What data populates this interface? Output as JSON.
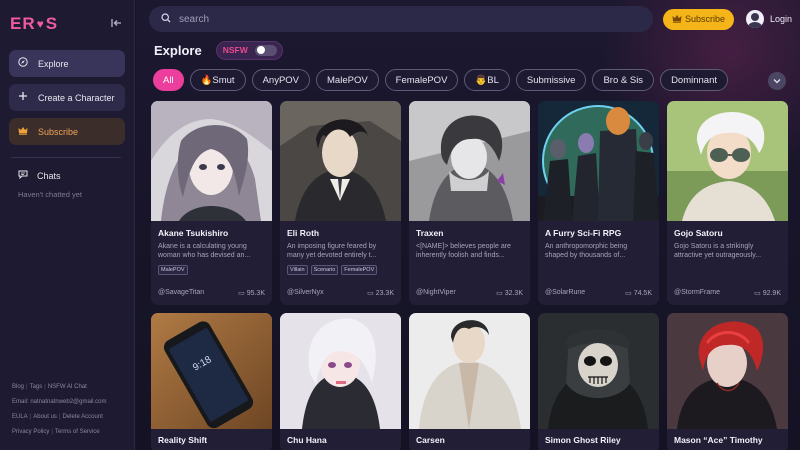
{
  "brand": {
    "logo_left": "ER",
    "logo_heart": "♥",
    "logo_right": "S"
  },
  "sidebar": {
    "collapse_icon": "collapse-icon",
    "items": [
      {
        "label": "Explore",
        "icon": "compass-icon"
      },
      {
        "label": "Create a Character",
        "icon": "plus-icon"
      },
      {
        "label": "Subscribe",
        "icon": "crown-icon"
      }
    ],
    "chats_label": "Chats",
    "chats_empty": "Haven't chatted yet",
    "footer": {
      "blog": "Blog",
      "tags": "Tags",
      "nsfw_ai_chat": "NSFW AI Chat",
      "email": "Email: natnatnatnweb2@gmail.com",
      "eula": "EULA",
      "about": "About us",
      "delete": "Delete Account",
      "privacy": "Privacy Policy",
      "terms": "Terms of Service"
    }
  },
  "header": {
    "search_placeholder": "search",
    "subscribe_label": "Subscribe",
    "login_label": "Login"
  },
  "explore": {
    "title": "Explore",
    "nsfw_label": "NSFW",
    "nsfw_on": false
  },
  "tags": [
    "All",
    "🔥Smut",
    "AnyPOV",
    "MalePOV",
    "FemalePOV",
    "👨BL",
    "Submissive",
    "Bro & Sis",
    "Dominnant"
  ],
  "cards": [
    {
      "name": "Akane Tsukishiro",
      "desc": "Akane is a calculating young woman who has devised an...",
      "chips": [
        "MalePOV"
      ],
      "author": "@SavageTitan",
      "chats": "95.3K"
    },
    {
      "name": "Eli Roth",
      "desc": "An imposing figure feared by many yet devoted entirely t...",
      "chips": [
        "Villain",
        "Scenario",
        "FemalePOV"
      ],
      "author": "@SilverNyx",
      "chats": "23.3K"
    },
    {
      "name": "Traxen",
      "desc": "<[NAME]> believes people are inherently foolish and finds...",
      "chips": [],
      "author": "@NightViper",
      "chats": "32.3K"
    },
    {
      "name": "A Furry Sci-Fi RPG",
      "desc": "An anthropomorphic being shaped by thousands of...",
      "chips": [],
      "author": "@SolarRune",
      "chats": "74.5K"
    },
    {
      "name": "Gojo Satoru",
      "desc": "Gojo Satoru is a strikingly attractive yet outrageously...",
      "chips": [],
      "author": "@StormFrame",
      "chats": "92.9K"
    },
    {
      "name": "Reality Shift",
      "desc": "",
      "chips": [],
      "author": "",
      "chats": ""
    },
    {
      "name": "Chu Hana",
      "desc": "",
      "chips": [],
      "author": "",
      "chats": ""
    },
    {
      "name": "Carsen",
      "desc": "",
      "chips": [],
      "author": "",
      "chats": ""
    },
    {
      "name": "Simon Ghost Riley",
      "desc": "",
      "chips": [],
      "author": "",
      "chats": ""
    },
    {
      "name": "Mason “Ace” Timothy",
      "desc": "",
      "chips": [],
      "author": "",
      "chats": ""
    }
  ],
  "colors": {
    "accent_pink": "#ec3f9d",
    "subscribe_gold": "#f5b417",
    "sidebar_bg": "#1e1a31",
    "page_bg": "#17142a"
  }
}
